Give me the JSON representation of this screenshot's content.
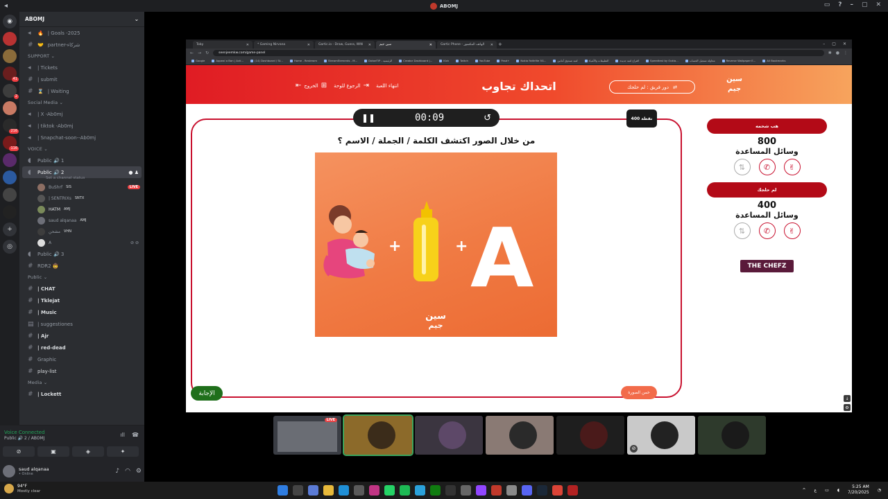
{
  "window": {
    "title": "ABOMJ"
  },
  "server": {
    "name": "ABOMJ"
  },
  "guild_badges": [
    "41",
    "2",
    "216",
    "116"
  ],
  "channels": {
    "top": [
      {
        "name": "| Goals -2025",
        "prefix": "🔥"
      },
      {
        "name": "partner-شركاء",
        "prefix": "🤝"
      }
    ],
    "support_cat": "SUPPORT",
    "support": [
      {
        "name": "| Tickets"
      },
      {
        "name": "| submit"
      },
      {
        "name": "| Waiting"
      }
    ],
    "social_cat": "Social Media",
    "social": [
      {
        "name": "| X -Ab0mj"
      },
      {
        "name": "| tiktok -Ab0mj"
      },
      {
        "name": "| Snapchat-soon--Ab0mj"
      }
    ],
    "voice_cat": "VOICE",
    "public1": "Public 🔊 1",
    "public2": "Public 🔊 2",
    "public2_status": "Set a channel status",
    "voice_users": [
      {
        "name": "BuShrf",
        "tag": "SIS",
        "live": "LIVE"
      },
      {
        "name": "| SENTRIXs",
        "tag": "SNTX"
      },
      {
        "name": "HATM",
        "tag": "AMJ"
      },
      {
        "name": "saud alqanaa",
        "tag": "AMJ"
      },
      {
        "name": "مشحن",
        "tag": "VHN"
      },
      {
        "name": "A",
        "tag": ""
      }
    ],
    "public3": "Public 🔊 3",
    "rdr2": "RDR2 🤠",
    "public_cat": "Public",
    "public_list": [
      {
        "name": "| CHAT"
      },
      {
        "name": "| Tklejat"
      },
      {
        "name": "| Music"
      },
      {
        "name": "| suggestiones"
      },
      {
        "name": "| Ajr"
      },
      {
        "name": "| red-dead"
      },
      {
        "name": "Graphic"
      },
      {
        "name": "play-list"
      }
    ],
    "media_cat": "Media",
    "media": [
      {
        "name": "| Lockett"
      }
    ]
  },
  "voice_panel": {
    "status": "Voice Connected",
    "channel": "Public 🔊 2 / ABOMJ"
  },
  "user_panel": {
    "name": "saud alqanaa",
    "status": "• Online"
  },
  "browser": {
    "tabs": [
      "Toby",
      "* Gaming Nirvana",
      "Gartic.io - Draw, Guess, WIN",
      "سين جيم",
      "Gartic Phone - الهاتف المكسور"
    ],
    "url": "seenjeemkw.com/game-panel",
    "bookmarks": [
      "Google",
      "Appeal a Ban | Acti...",
      "(14) Dashboard / St...",
      "Home - Restream",
      "StreamElements - M...",
      "DotaeTIP - الرئيسية",
      "Creator Dashboard |...",
      "Kick",
      "Twitch",
      "YouTube",
      "Pasd+",
      "Nokia Faithfile 5G...",
      "لعبة صندوق أمانين",
      "التطبيقات والأشياء",
      "اقتراح لعبة جديدة",
      "Speedtest by Ookla...",
      "محاولة تسجيل الحساب",
      "Reverse Wallpaper E...",
      "All Bookmarks"
    ]
  },
  "game": {
    "logo_top": "سين",
    "logo_bottom": "جيم",
    "turn": "دور فريق : لم حلجك",
    "title": "اتحداك تجاوب",
    "end_game": "انتهاء اللعبة",
    "back_board": "الرجوع للوحة",
    "exit": "الخروج",
    "timer": "00:09",
    "points": "400 نقطة",
    "question": "من خلال الصور اكتشف الكلمة / الجملة / الاسم ؟",
    "answer_btn": "الإجابة",
    "guess_btn": "خمن الصورة",
    "image_plus": "+",
    "image_letter": "A",
    "watermark_top": "سين",
    "watermark_bottom": "جيم",
    "teams": [
      {
        "name": "هب شحمه",
        "score": "800",
        "help": "وسائل المساعدة"
      },
      {
        "name": "لم حلجك",
        "score": "400",
        "help": "وسائل المساعدة"
      }
    ],
    "sponsor": "THE CHEFZ"
  },
  "stream_tiles": [
    {
      "live": "LIVE"
    }
  ],
  "taskbar": {
    "temp": "94°F",
    "weather": "Mostly clear",
    "time": "5:25 AM",
    "date": "7/20/2025",
    "lang": "ع"
  },
  "colors": {
    "accent": "#e01c24",
    "team": "#b30a17",
    "frame": "#c8102e",
    "discord_bg": "#2b2d31"
  }
}
